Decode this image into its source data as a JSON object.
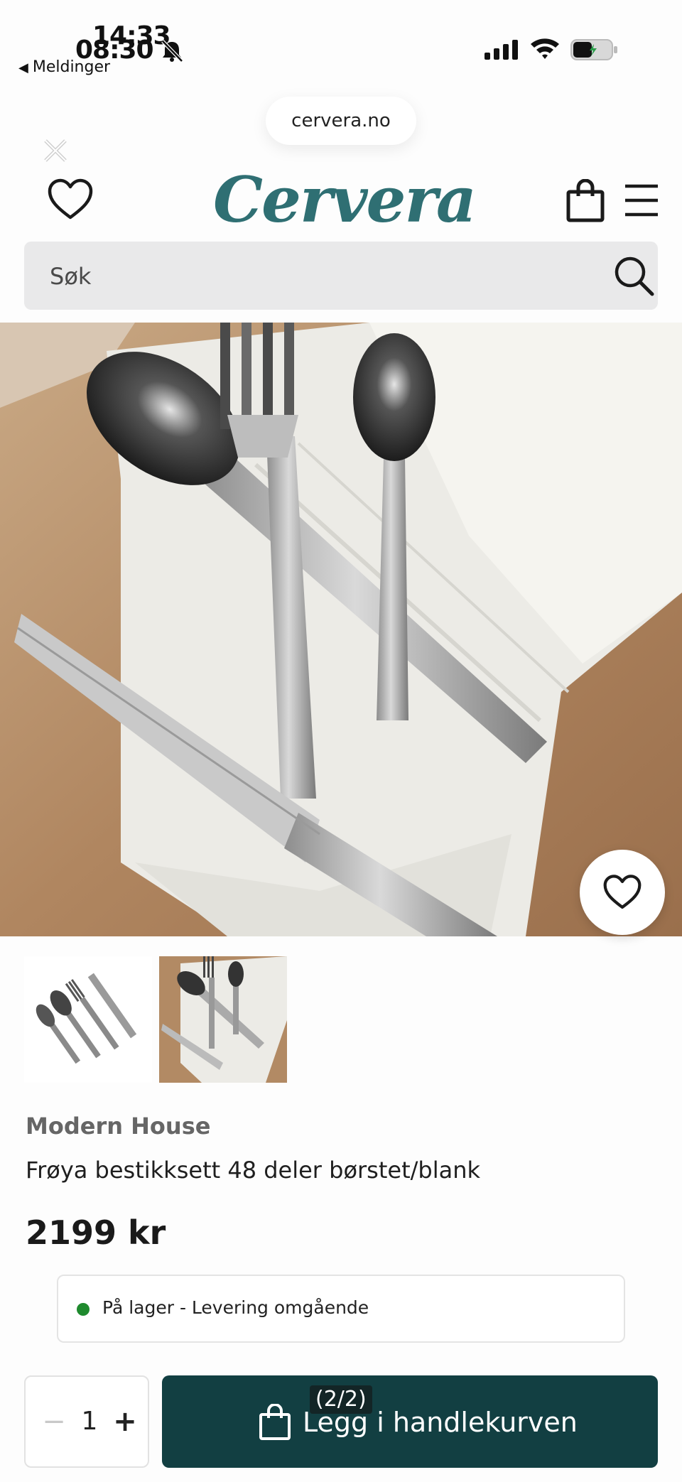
{
  "status_bar": {
    "time_primary": "14:33",
    "time_secondary": "08:30",
    "back_app": "Meldinger"
  },
  "browser": {
    "url": "cervera.no"
  },
  "header": {
    "logo_text": "Cervera",
    "brand_color": "#2f6f73"
  },
  "search": {
    "placeholder": "Søk"
  },
  "product": {
    "brand": "Modern House",
    "title": "Frøya bestikksett 48 deler børstet/blank",
    "price": "2199 kr",
    "stock_text": "På lager - Levering omgående",
    "stock_color": "#1f8a2e"
  },
  "purchase": {
    "minus": "−",
    "quantity": "1",
    "plus": "+",
    "add_to_cart": "Legg i handlekurven",
    "button_color": "#123f42",
    "page_indicator": "(2/2)"
  },
  "icons": {
    "header_left": "heart-icon",
    "header_cart": "shopping-bag-icon",
    "header_menu": "hamburger-menu-icon",
    "search": "search-icon",
    "close": "close-icon",
    "wishlist": "heart-icon"
  }
}
